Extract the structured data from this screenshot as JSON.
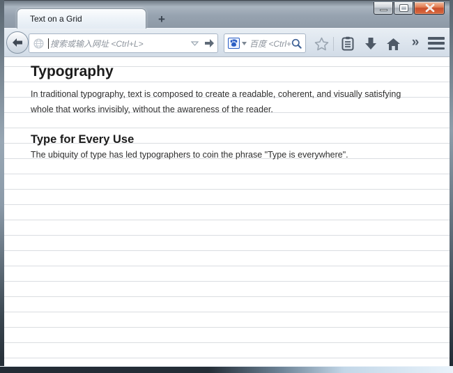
{
  "window": {
    "tab_title": "Text on a Grid",
    "new_tab_label": "+"
  },
  "navbar": {
    "url_placeholder": "搜索或输入网址 <Ctrl+L>",
    "search_placeholder": "百度 <Ctrl+K",
    "overflow_label": "»"
  },
  "content": {
    "heading": "Typography",
    "intro": "In traditional typography, text is composed to create a readable, coherent, and visually satisfying whole that works invisibly, without the awareness of the reader.",
    "subheading": "Type for Every Use",
    "body": "The ubiquity of type has led typographers to coin the phrase \"Type is everywhere\"."
  },
  "colors": {
    "titlebar": "#97a3b0",
    "toolbar": "#dde5ee",
    "grid_line": "#dadde1",
    "close_button": "#c94f2d",
    "baidu_blue": "#2a5ec4",
    "icon_gray": "#4e5966"
  }
}
